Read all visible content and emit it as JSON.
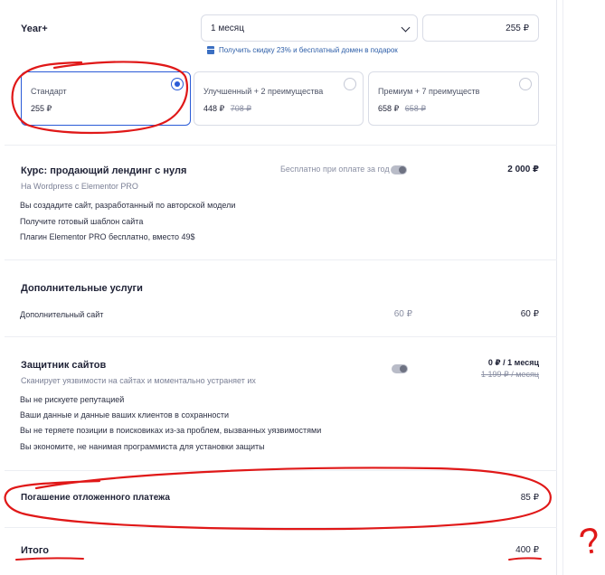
{
  "header": {
    "title": "Year+",
    "period_select": "1 месяц",
    "period_price": "255 ₽",
    "promo": "Получить скидку 23% и бесплатный домен в подарок"
  },
  "plans": [
    {
      "name": "Стандарт",
      "price": "255 ₽",
      "old_price": "",
      "selected": true
    },
    {
      "name": "Улучшенный + 2 преимущества",
      "price": "448 ₽",
      "old_price": "708 ₽",
      "selected": false
    },
    {
      "name": "Премиум + 7 преимуществ",
      "price": "658 ₽",
      "old_price": "658 ₽",
      "selected": false
    }
  ],
  "course": {
    "title": "Курс: продающий лендинг с нуля",
    "subtitle": "На Wordpress с Elementor PRO",
    "toggle_label": "Бесплатно при оплате за год",
    "price": "2 000 ₽",
    "items": [
      "Вы создадите сайт, разработанный по авторской модели",
      "Получите готовый шаблон сайта",
      "Плагин Elementor PRO бесплатно, вместо 49$"
    ]
  },
  "extra_services": {
    "title": "Дополнительные услуги",
    "row_label": "Дополнительный сайт",
    "row_unit_price": "60 ₽",
    "row_total": "60 ₽"
  },
  "protector": {
    "title": "Защитник сайтов",
    "subtitle": "Сканирует уязвимости на сайтах и моментально устраняет их",
    "price": "0 ₽ / 1 месяц",
    "old_price": "1 199 ₽ / месяц",
    "items": [
      "Вы не рискуете репутацией",
      "Ваши данные и данные ваших клиентов в сохранности",
      "Вы не теряете позиции в поисковиках из-за проблем, вызванных уязвимостями",
      "Вы экономите, не нанимая программиста для установки защиты"
    ]
  },
  "deferred": {
    "label": "Погашение отложенного платежа",
    "amount": "85 ₽"
  },
  "total": {
    "label": "Итого",
    "amount": "400 ₽"
  },
  "annotations": {
    "question_mark": "?",
    "ink_color": "#e01818"
  },
  "colors": {
    "accent": "#2a5bd7",
    "border": "#d9dce6"
  }
}
